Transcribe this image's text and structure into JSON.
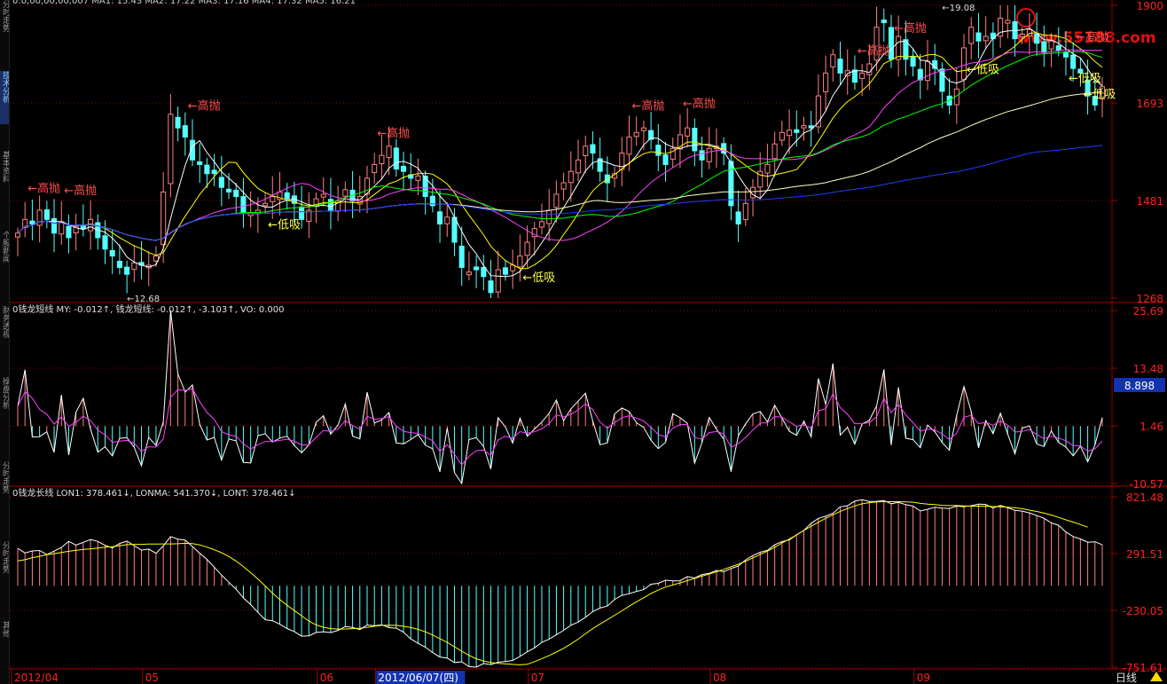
{
  "sidebar": {
    "tabs": [
      {
        "label": "分时走势",
        "active": false
      },
      {
        "label": "技术分析",
        "active": true
      },
      {
        "label": "基本资料",
        "active": false
      },
      {
        "label": "个股新闻",
        "active": false
      },
      {
        "label": "财务透视",
        "active": false
      },
      {
        "label": "操盘分析",
        "active": false
      },
      {
        "label": "分时走势",
        "active": false
      },
      {
        "label": "分时走势",
        "active": false
      },
      {
        "label": "其他",
        "active": false
      }
    ]
  },
  "top_info_text": "0:0,00,00,00,007 MA1: 15.43 MA2: 17.22 MA3: 17.16 MA4: 17.32 MA5: 16.21",
  "watermark": "www.55188.com",
  "colors": {
    "up": "#ff8080",
    "down": "#54ffff",
    "ma1": "#ffffff",
    "ma2": "#ffff00",
    "ma3": "#ff40ff",
    "ma4": "#00ff00",
    "ma5": "#ffffcc",
    "ma6": "#1f3bff",
    "grid": "#8b0000",
    "axis": "#a00000",
    "annot_high": "#ff5050",
    "annot_low": "#ffff50"
  },
  "chart_data": [
    {
      "type": "candlestick",
      "title": "",
      "y_ticks": [
        "1900",
        "1693",
        "1481",
        "1268"
      ],
      "ylim": [
        12.68,
        19.08
      ],
      "price_low_label": "12.68",
      "price_high_label": "19.08",
      "annotations": [
        {
          "text": "高抛",
          "kind": "high",
          "bar": 6
        },
        {
          "text": "高抛",
          "kind": "high",
          "bar": 1
        },
        {
          "text": "高抛",
          "kind": "high",
          "bar": 23
        },
        {
          "text": "高抛",
          "kind": "high",
          "bar": 49
        },
        {
          "text": "高抛",
          "kind": "high",
          "bar": 84
        },
        {
          "text": "高抛",
          "kind": "high",
          "bar": 91
        },
        {
          "text": "高抛",
          "kind": "high",
          "bar": 115
        },
        {
          "text": "高抛",
          "kind": "high",
          "bar": 120
        },
        {
          "text": "高抛",
          "kind": "high",
          "bar": 145
        },
        {
          "text": "低吸",
          "kind": "low",
          "bar": 34
        },
        {
          "text": "低吸",
          "kind": "low",
          "bar": 69
        },
        {
          "text": "低吸",
          "kind": "low",
          "bar": 130
        },
        {
          "text": "低吸",
          "kind": "low",
          "bar": 144
        },
        {
          "text": "低吸",
          "kind": "low",
          "bar": 146
        }
      ],
      "close": [
        14.1,
        14.4,
        14.3,
        14.6,
        14.4,
        14.1,
        14.35,
        14.0,
        14.25,
        14.2,
        14.4,
        14.0,
        13.75,
        13.6,
        13.35,
        13.2,
        13.45,
        13.4,
        13.4,
        13.6,
        15.0,
        16.7,
        16.4,
        16.2,
        15.7,
        15.6,
        15.4,
        15.4,
        15.1,
        15.0,
        14.9,
        14.55,
        14.55,
        14.6,
        14.75,
        14.9,
        15.0,
        14.85,
        14.75,
        14.4,
        14.6,
        14.85,
        14.95,
        14.6,
        14.8,
        15.05,
        14.8,
        14.9,
        15.3,
        15.6,
        15.8,
        16.0,
        15.5,
        15.45,
        15.3,
        15.35,
        14.9,
        14.7,
        14.3,
        14.45,
        13.9,
        13.35,
        13.25,
        13.3,
        13.15,
        12.8,
        13.3,
        13.2,
        13.4,
        13.6,
        13.9,
        14.2,
        14.35,
        14.6,
        14.95,
        15.2,
        15.45,
        15.7,
        16.0,
        15.85,
        15.45,
        15.2,
        15.4,
        15.85,
        16.2,
        16.3,
        16.4,
        16.15,
        15.8,
        15.6,
        15.95,
        16.25,
        16.4,
        15.9,
        15.7,
        15.95,
        16.0,
        15.85,
        14.7,
        14.3,
        14.75,
        15.1,
        15.45,
        15.6,
        16.05,
        16.3,
        16.35,
        16.3,
        16.45,
        16.4,
        17.1,
        17.6,
        18.0,
        17.6,
        17.65,
        17.4,
        17.6,
        17.8,
        18.6,
        18.7,
        17.9,
        18.4,
        17.9,
        17.75,
        17.45,
        17.85,
        17.7,
        17.2,
        16.9,
        17.25,
        18.15,
        18.6,
        18.3,
        18.4,
        18.35,
        18.8,
        18.75,
        18.35,
        18.45,
        18.55,
        18.25,
        18.05,
        18.3,
        18.1,
        17.95,
        17.7,
        17.6,
        17.1,
        16.9,
        17.3
      ]
    },
    {
      "type": "histogram+line",
      "title": "0钱龙短线 MY: -0.012↑, 钱龙短线: -0.012↑, -3.103↑, VO: 0.000",
      "y_ticks": [
        "25.69",
        "13.48",
        "1.46",
        "-10.57"
      ],
      "last_value_badge": "8.898",
      "series": [
        {
          "name": "MY",
          "values": [
            5.58,
            13.26,
            -0.81,
            -0.77,
            0.28,
            -4.06,
            7.99,
            -4.58,
            4.38,
            7.3,
            0.82,
            -4.01,
            -2.87,
            -4.79,
            -1.1,
            -0.97,
            -2.97,
            -6.87,
            -0.9,
            -2.63,
            2.4,
            25.69,
            12.41,
            8.6,
            10.09,
            1.86,
            -1.46,
            -0.9,
            -5.68,
            -1.25,
            -1.62,
            -6.16,
            -6.28,
            -0.54,
            -0.14,
            -1.89,
            -1.05,
            -0.67,
            -2.59,
            -4.14,
            -2.48,
            2.26,
            3.64,
            -0.24,
            1.69,
            6.11,
            -0.64,
            -1.22,
            8.58,
            2.12,
            2.76,
            4.31,
            -2.06,
            -2.25,
            -1.37,
            -0.31,
            -2.56,
            -3.3,
            -8.11,
            1.06,
            -8.27,
            -10.57,
            -1.37,
            -0.95,
            -2.79,
            -7.53,
            3.2,
            1.29,
            -2.1,
            3.13,
            -0.65,
            0.85,
            2.32,
            4.14,
            6.92,
            2.6,
            5.07,
            6.69,
            8.37,
            2.56,
            -2.45,
            -2.05,
            4.02,
            5.25,
            4.51,
            2.19,
            1.18,
            -1.5,
            -3.27,
            -1.95,
            4.07,
            3.23,
            2.06,
            -6.31,
            -2.01,
            3.26,
            0.8,
            -1.25,
            -8.1,
            -0.56,
            1.94,
            4.02,
            4.52,
            2.35,
            5.85,
            3.16,
            0.38,
            -0.48,
            2.5,
            -0.8,
            11.45,
            5.99,
            14.59,
            -0.44,
            1.19,
            -2.34,
            1.93,
            2.68,
            5.7,
            13.35,
            -2.51,
            9.56,
            -1.07,
            -1.39,
            -3.07,
            1.69,
            0.28,
            -1.97,
            -3.6,
            3.73,
            9.77,
            4.48,
            -3.1,
            2.61,
            -0.14,
            4.2,
            -0.18,
            -4.36,
            1.01,
            1.52,
            -2.27,
            -2.82,
            0.44,
            -1.95,
            -2.95,
            -4.76,
            -2.75,
            -6.06,
            -2.46,
            3.24
          ]
        },
        {
          "name": "钱龙短线",
          "values": [
            5.58,
            8.63,
            7.33,
            4.95,
            3.95,
            1.85,
            3.39,
            1.44,
            2.27,
            3.54,
            2.64,
            0.6,
            -0.39,
            -1.93,
            -1.68,
            -1.53,
            -2.13,
            -3.86,
            -2.88,
            -2.94,
            -1.18,
            7.5,
            9.13,
            8.93,
            9.32,
            6.6,
            4.31,
            2.87,
            0.3,
            -0.35,
            -0.65,
            -2.25,
            -3.33,
            -2.42,
            -1.77,
            -1.78,
            -1.54,
            -1.29,
            -1.71,
            -2.49,
            -2.49,
            -0.92,
            0.53,
            0.35,
            0.86,
            2.6,
            1.57,
            0.81,
            3.52,
            2.91,
            3.04,
            3.45,
            1.45,
            0.39,
            0.06,
            -0.04,
            -0.86,
            -1.6,
            -3.86,
            -2.42,
            -4.41,
            -6.65,
            -4.88,
            -3.69,
            -3.54,
            -4.68,
            -1.46,
            -0.66,
            -1.1,
            0.31,
            -0.01,
            0.27,
            0.89,
            2.0,
            3.81,
            3.37,
            3.93,
            4.84,
            6.11,
            4.92,
            2.32,
            1.01,
            2.19,
            3.22,
            3.63,
            3.14,
            2.52,
            1.2,
            -0.29,
            -0.81,
            1.05,
            1.74,
            1.84,
            -0.92,
            -1.3,
            0.1,
            0.33,
            -0.15,
            -2.97,
            -2.22,
            -0.92,
            0.62,
            2.08,
            2.17,
            3.45,
            3.35,
            2.35,
            1.4,
            1.74,
            0.96,
            4.66,
            5.08,
            8.27,
            5.33,
            3.96,
            1.97,
            1.96,
            2.2,
            3.44,
            7.31,
            4.28,
            6.04,
            3.81,
            2.17,
            0.39,
            0.85,
            0.67,
            -0.16,
            -1.35,
            0.0,
            3.3,
            3.71,
            1.98,
            2.23,
            1.64,
            2.55,
            1.66,
            0.21,
            0.35,
            0.71,
            -0.3,
            -1.16,
            -0.66,
            -1.03,
            -1.6,
            -2.63,
            -2.68,
            -3.81,
            -3.32,
            -1.68
          ]
        }
      ]
    },
    {
      "type": "histogram+line",
      "title": "0钱龙长线 LON1: 378.461↓, LONMA: 541.370↓, LONT: 378.461↓",
      "y_ticks": [
        "821.48",
        "291.51",
        "-230.05",
        "-751.61"
      ],
      "series": [
        {
          "name": "LON1",
          "values": [
            346.13,
            302.79,
            321.49,
            326.05,
            287.05,
            319.8,
            353.56,
            410.15,
            375.6,
            400.86,
            427.59,
            409.25,
            373.59,
            349.67,
            390.56,
            412.56,
            371.12,
            329.2,
            339.16,
            299.58,
            368.51,
            454.19,
            430.73,
            422.63,
            362.41,
            300.21,
            244.19,
            171.45,
            98.63,
            32.79,
            -31.78,
            -111.36,
            -173.65,
            -246.49,
            -313.41,
            -322.99,
            -355.19,
            -395.5,
            -423.01,
            -465.5,
            -462.5,
            -431.37,
            -424.85,
            -431.96,
            -412.5,
            -377.17,
            -385.76,
            -405.12,
            -362.25,
            -369.96,
            -360.68,
            -386.4,
            -391.6,
            -427.57,
            -491.29,
            -530.85,
            -567.18,
            -617.2,
            -658.29,
            -667.08,
            -708.9,
            -702.24,
            -747.0,
            -751.61,
            -718.16,
            -727.67,
            -706.91,
            -698.85,
            -689.88,
            -651.49,
            -609.92,
            -573.49,
            -523.09,
            -492.79,
            -452.14,
            -411.65,
            -364.56,
            -335.54,
            -291.43,
            -238.6,
            -206.1,
            -187.31,
            -125.31,
            -88.9,
            -73.36,
            -52.12,
            -35.85,
            14.46,
            22.73,
            51.16,
            45.11,
            46.11,
            85.25,
            72.11,
            104.15,
            114.15,
            141.82,
            130.69,
            159.86,
            182.59,
            238.73,
            279.38,
            309.37,
            326.5,
            378.57,
            407.87,
            423.81,
            470.93,
            512.1,
            577.63,
            622.68,
            641.68,
            669.29,
            728.88,
            739.58,
            780.99,
            794.13,
            779.21,
            779.62,
            785.89,
            757.69,
            769.49,
            749.17,
            735.35,
            690.86,
            705.99,
            725.64,
            717.6,
            714.5,
            735.46,
            730.48,
            739.87,
            754.1,
            751.33,
            717.22,
            741.65,
            719.56,
            696.79,
            689.56,
            673.55,
            648.06,
            622.84,
            580.62,
            558.36,
            496.16,
            454.5,
            432.05,
            401.91,
            405.69,
            378.46
          ]
        },
        {
          "name": "LONMA",
          "values": [
            229.13,
            240.66,
            259.39,
            271.96,
            286.3,
            296.35,
            307.99,
            318.19,
            326.96,
            335.71,
            339.47,
            348.38,
            356.99,
            361.24,
            370.01,
            379.54,
            382.71,
            382.43,
            385.36,
            385.91,
            386.32,
            386.77,
            387.96,
            392.14,
            389.31,
            377.16,
            357.14,
            333.42,
            304.96,
            270.49,
            228.68,
            177.64,
            121.1,
            60.85,
            -1.97,
            -68.1,
            -126.98,
            -180.91,
            -228.89,
            -277.3,
            -326.72,
            -361.49,
            -383.29,
            -395.87,
            -400.11,
            -399.52,
            -396.08,
            -391.55,
            -384.13,
            -373.78,
            -365.63,
            -363.87,
            -366.07,
            -373.67,
            -386.3,
            -402.19,
            -425.9,
            -454.94,
            -488.22,
            -523.47,
            -563.3,
            -604.98,
            -642.43,
            -673.89,
            -695.2,
            -707.94,
            -716.53,
            -720.8,
            -725.91,
            -730.41,
            -725.22,
            -701.06,
            -672.95,
            -644.13,
            -612.47,
            -577.91,
            -536.83,
            -492.84,
            -443.49,
            -395.96,
            -353.18,
            -313.86,
            -272.28,
            -230.99,
            -188.84,
            -147.68,
            -110.79,
            -71.52,
            -39.87,
            -11.41,
            7.18,
            26.77,
            47.34,
            68.43,
            89.04,
            108.61,
            129.48,
            151.56,
            175.26,
            198.9,
            226.23,
            258.11,
            287.97,
            319.85,
            355.56,
            395.39,
            431.73,
            470.2,
            509.85,
            549.15,
            586.73,
            622.14,
            654.88,
            686.93,
            713.06,
            736.85,
            756.53,
            767.69,
            774.98,
            777.58,
            776.45,
            776.31,
            774.63,
            771.8,
            760.81,
            754.36,
            749.41,
            743.04,
            740.34,
            740.99,
            738.29,
            734.8,
            735.78,
            734.69,
            731.96,
            729.75,
            724.73,
            719.55,
            711.52,
            698.88,
            686.46,
            670.64,
            653.53,
            631.44,
            608.53,
            587.94,
            565.29,
            541.37
          ]
        }
      ]
    }
  ],
  "x_labels": [
    {
      "text": "2012/04",
      "bar": 0,
      "highlight": false
    },
    {
      "text": "05",
      "bar": 18,
      "highlight": false
    },
    {
      "text": "06",
      "bar": 42,
      "highlight": false
    },
    {
      "text": "2012/06/07(四)",
      "bar": 50,
      "highlight": true
    },
    {
      "text": "07",
      "bar": 71,
      "highlight": false
    },
    {
      "text": "08",
      "bar": 96,
      "highlight": false
    },
    {
      "text": "09",
      "bar": 124,
      "highlight": false
    }
  ],
  "period_label": "日线"
}
